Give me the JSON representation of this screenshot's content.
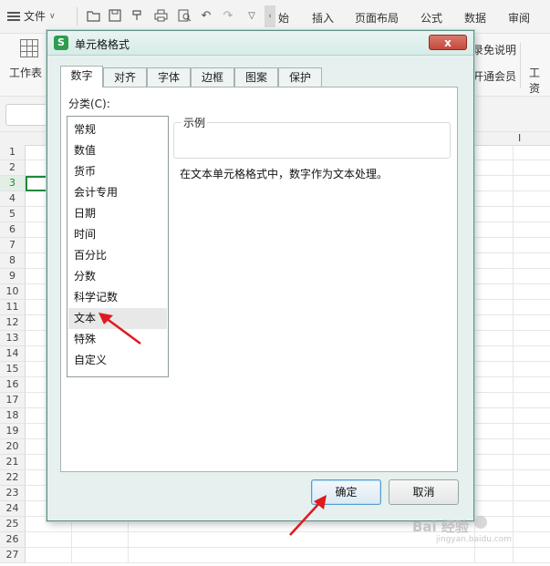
{
  "toolbar": {
    "menu_label": "文件",
    "tabs": [
      "始",
      "插入",
      "页面布局",
      "公式",
      "数据",
      "审阅"
    ]
  },
  "ribbon": {
    "workbook_label": "工作表",
    "right_texts": [
      "录免说明",
      "开通会员",
      "工资"
    ]
  },
  "sheet": {
    "rows": [
      "1",
      "2",
      "3",
      "4",
      "5",
      "6",
      "7",
      "8",
      "9",
      "10",
      "11",
      "12",
      "13",
      "14",
      "15",
      "16",
      "17",
      "18",
      "19",
      "20",
      "21",
      "22",
      "23",
      "24",
      "25",
      "26",
      "27"
    ],
    "active_row": "3",
    "col_letter": "I"
  },
  "dialog": {
    "title": "单元格格式",
    "close_label": "x",
    "tabs": [
      "数字",
      "对齐",
      "字体",
      "边框",
      "图案",
      "保护"
    ],
    "active_tab": "数字",
    "category_label": "分类(C):",
    "categories": [
      "常规",
      "数值",
      "货币",
      "会计专用",
      "日期",
      "时间",
      "百分比",
      "分数",
      "科学记数",
      "文本",
      "特殊",
      "自定义"
    ],
    "selected_category": "文本",
    "sample_label": "示例",
    "description": "在文本单元格格式中，数字作为文本处理。",
    "ok_label": "确定",
    "cancel_label": "取消"
  },
  "watermark": {
    "brand": "Bai 经验",
    "url": "jingyan.baidu.com"
  },
  "colors": {
    "dialog_bg": "#e6f1ef",
    "accent_green": "#1d8a3b",
    "arrow_red": "#e0191e",
    "close_red": "#c7483a"
  }
}
